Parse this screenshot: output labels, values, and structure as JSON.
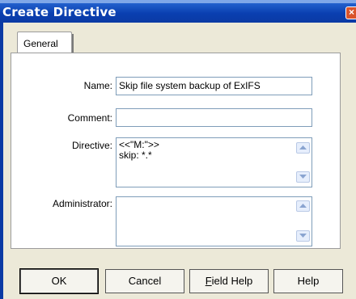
{
  "window": {
    "title": "Create Directive"
  },
  "tabs": [
    {
      "label": "General"
    }
  ],
  "form": {
    "name": {
      "label": "Name:",
      "value": "Skip file system backup of ExIFS"
    },
    "comment": {
      "label": "Comment:",
      "value": ""
    },
    "directive": {
      "label": "Directive:",
      "value": "<<\"M:\">>\nskip: *.*"
    },
    "administrator": {
      "label": "Administrator:",
      "value": ""
    }
  },
  "buttons": {
    "ok": "OK",
    "cancel": "Cancel",
    "field_help_mnemonic": "F",
    "field_help_rest": "ield Help",
    "help": "Help"
  },
  "icons": {
    "close": "close-icon",
    "up": "scroll-up-icon",
    "down": "scroll-down-icon"
  }
}
